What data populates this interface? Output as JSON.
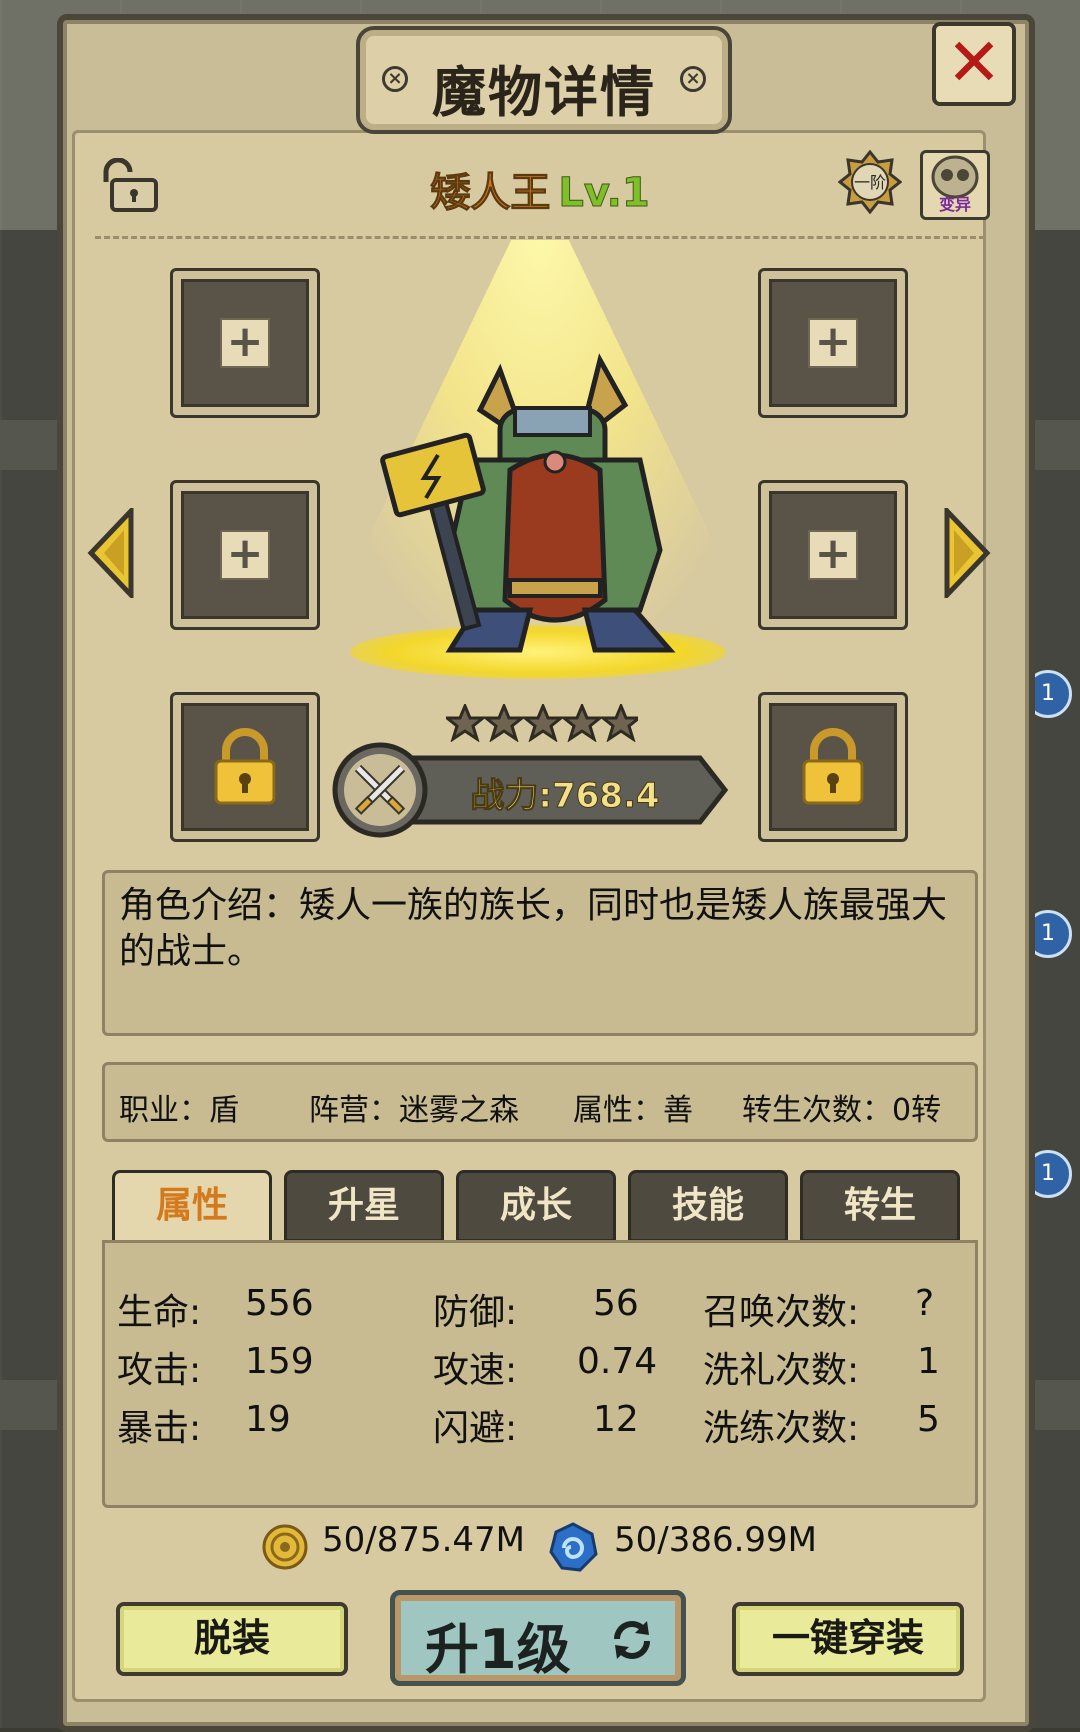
{
  "dialog": {
    "title": "魔物详情"
  },
  "monster": {
    "name": "矮人王",
    "level": "Lv.1",
    "tier": "一阶",
    "mutate_label": "变异",
    "stars": 5
  },
  "power": {
    "label": "战力:768.4"
  },
  "description": "角色介绍：矮人一族的族长，同时也是矮人族最强大的战士。",
  "info": {
    "job": "职业：盾",
    "camp": "阵营：迷雾之森",
    "attribute": "属性：善",
    "rebirth": "转生次数：0转"
  },
  "tabs": [
    "属性",
    "升星",
    "成长",
    "技能",
    "转生"
  ],
  "active_tab": "属性",
  "stats": {
    "hp_label": "生命:",
    "hp": "556",
    "atk_label": "攻击:",
    "atk": "159",
    "crit_label": "暴击:",
    "crit": "19",
    "def_label": "防御:",
    "def": "56",
    "spd_label": "攻速:",
    "spd": "0.74",
    "dodge_label": "闪避:",
    "dodge": "12",
    "summon_label": "召唤次数:",
    "summon": "?",
    "baptism_label": "洗礼次数:",
    "baptism": "1",
    "refine_label": "洗练次数:",
    "refine": "5"
  },
  "resources": {
    "gold": "50/875.47M",
    "crystal": "50/386.99M"
  },
  "buttons": {
    "unequip": "脱装",
    "upgrade": "升1级",
    "equip_all": "一键穿装"
  },
  "background": {
    "badge_1": "1",
    "badge_2": "1",
    "badge_3": "1"
  },
  "colors": {
    "name": "#d6721f",
    "level": "#7fbf2a",
    "active_tab_text": "#d57a1c",
    "close": "#b51b16"
  }
}
